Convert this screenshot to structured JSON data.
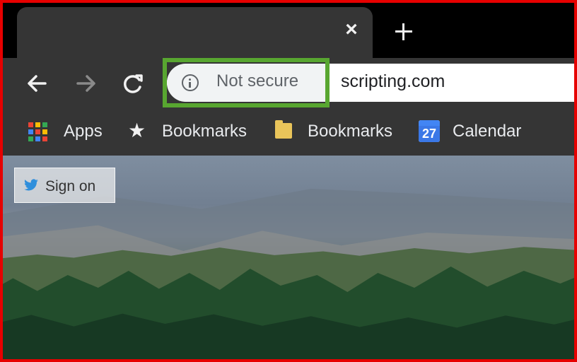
{
  "browser": {
    "tab": {
      "close_symbol": "×"
    },
    "toolbar": {
      "security_text": "Not secure",
      "url": "scripting.com"
    },
    "bookmarks": [
      {
        "label": "Apps",
        "icon": "apps-grid-icon"
      },
      {
        "label": "Bookmarks",
        "icon": "star-icon"
      },
      {
        "label": "Bookmarks",
        "icon": "folder-icon"
      },
      {
        "label": "Calendar",
        "icon": "calendar-icon",
        "calendar_day": "27"
      }
    ]
  },
  "page": {
    "sign_on_label": "Sign on",
    "sign_on_icon": "twitter-bird-icon"
  },
  "colors": {
    "frame_border": "#e60000",
    "highlight_border": "#58a630",
    "toolbar_bg": "#353535",
    "tab_bg": "#353535"
  }
}
